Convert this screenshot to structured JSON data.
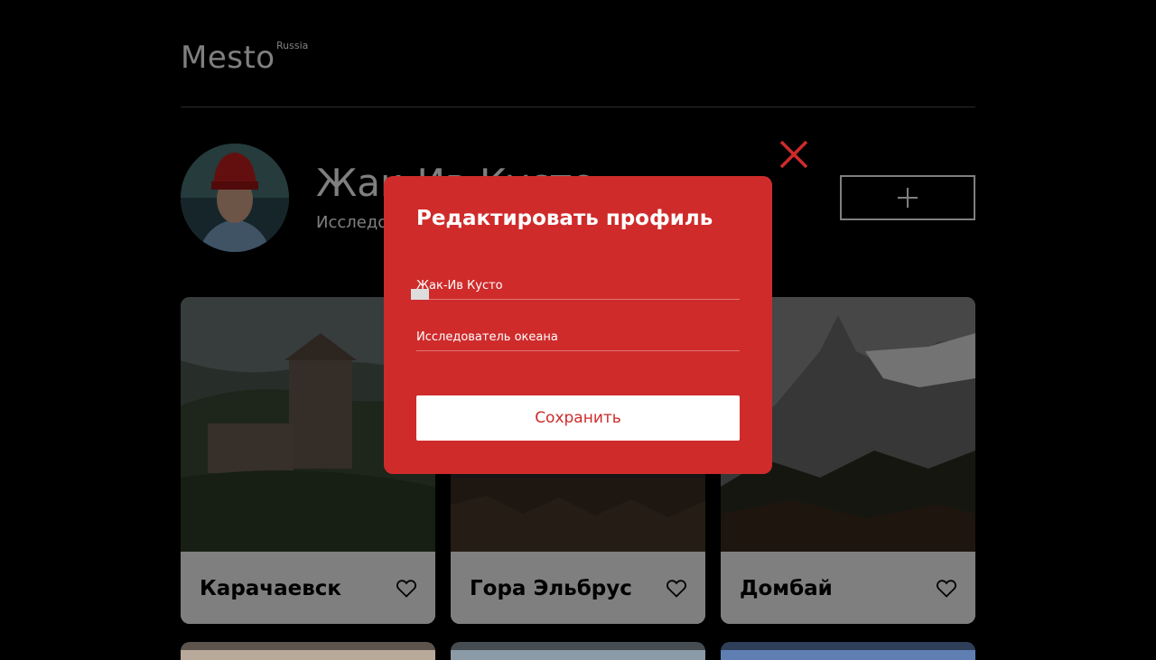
{
  "header": {
    "logo": "Mesto",
    "logo_sup": "Russia"
  },
  "profile": {
    "name": "Жак-Ив Кусто",
    "job": "Исследователь океана"
  },
  "cards": [
    {
      "title": "Карачаевск"
    },
    {
      "title": "Гора Эльбрус"
    },
    {
      "title": "Домбай"
    }
  ],
  "popup": {
    "title": "Редактировать профиль",
    "name_value": "Жак-Ив Кусто",
    "job_value": "Исследователь океана",
    "save_label": "Сохранить"
  },
  "icons": {
    "close": "close-icon",
    "add": "plus-icon",
    "like": "heart-icon"
  },
  "colors": {
    "popup_bg": "#cf2b2b",
    "background": "#000000"
  }
}
